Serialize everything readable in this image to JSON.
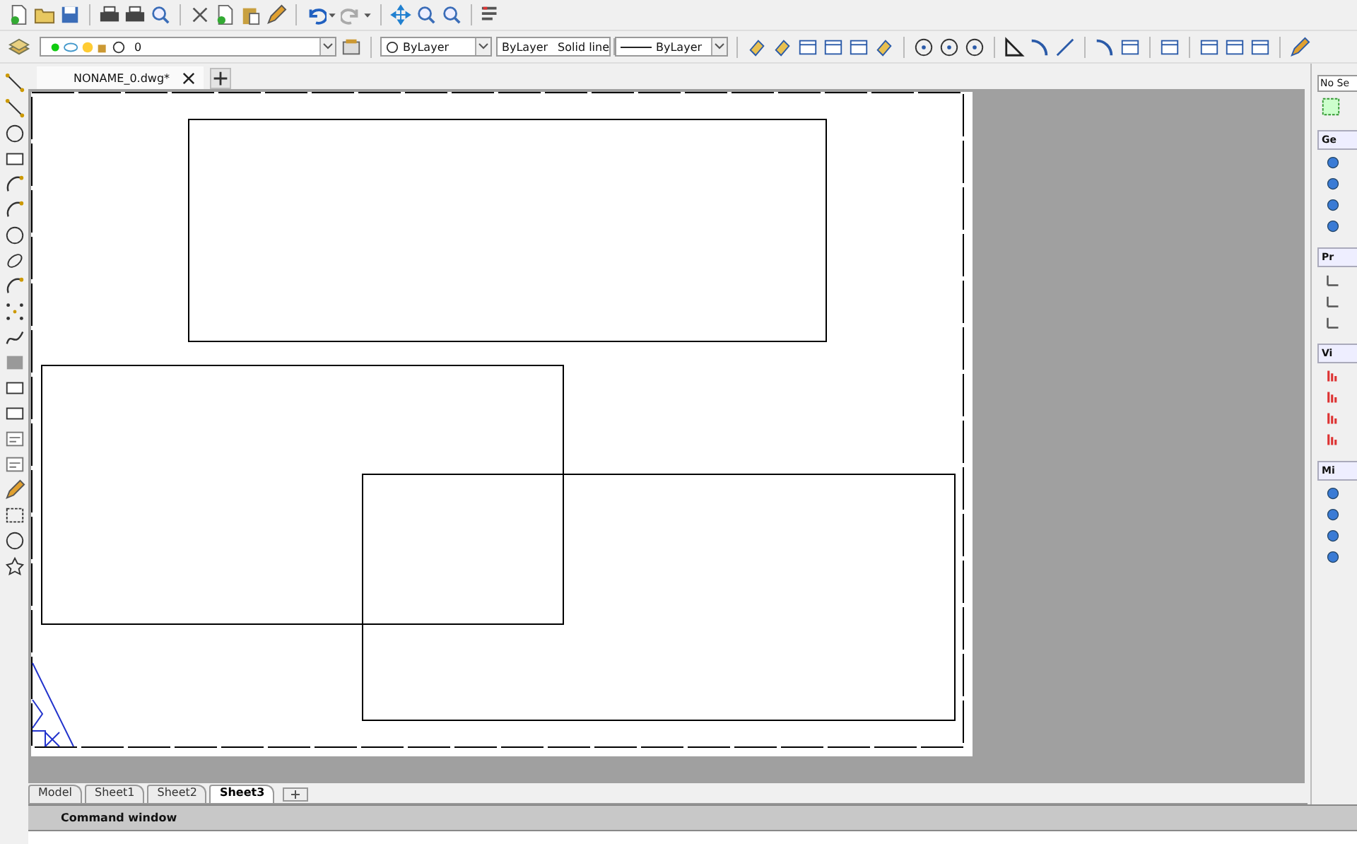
{
  "document_tabs": [
    {
      "label": "NONAME_0.dwg*",
      "selected": true
    }
  ],
  "layer_combo": {
    "value": "0"
  },
  "color_combo": {
    "value": "ByLayer"
  },
  "linetype_combo": {
    "value": "ByLayer",
    "description": "Solid line"
  },
  "lineweight_combo": {
    "value": "ByLayer"
  },
  "layout_tabs": [
    {
      "label": "Model",
      "selected": false
    },
    {
      "label": "Sheet1",
      "selected": false
    },
    {
      "label": "Sheet2",
      "selected": false
    },
    {
      "label": "Sheet3",
      "selected": true
    }
  ],
  "command_window": {
    "title": "Command window"
  },
  "properties_panel": {
    "selection": "No Se",
    "sections": [
      {
        "label": "Ge"
      },
      {
        "label": "Pr"
      },
      {
        "label": "Vi"
      },
      {
        "label": "Mi"
      }
    ]
  }
}
